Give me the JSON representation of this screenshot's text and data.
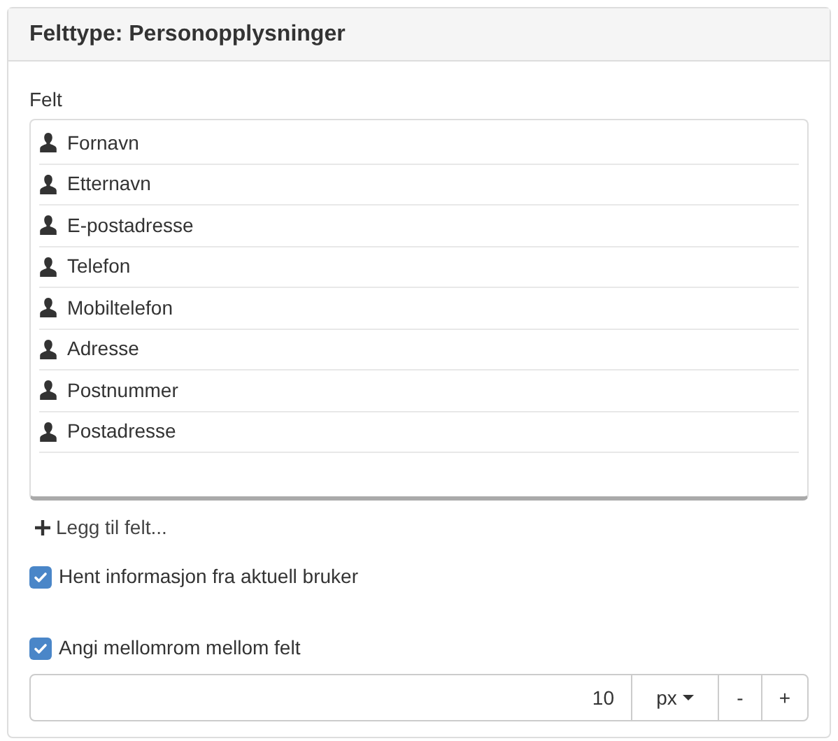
{
  "panel": {
    "title": "Felttype: Personopplysninger"
  },
  "fields": {
    "label": "Felt",
    "items": [
      {
        "label": "Fornavn"
      },
      {
        "label": "Etternavn"
      },
      {
        "label": "E-postadresse"
      },
      {
        "label": "Telefon"
      },
      {
        "label": "Mobiltelefon"
      },
      {
        "label": "Adresse"
      },
      {
        "label": "Postnummer"
      },
      {
        "label": "Postadresse"
      }
    ],
    "add_link": "Legg til felt..."
  },
  "options": [
    {
      "label": "Hent informasjon fra aktuell bruker",
      "checked": true
    },
    {
      "label": "Angi mellomrom mellom felt",
      "checked": true
    }
  ],
  "spacing": {
    "value": "10",
    "unit": "px",
    "decrement": "-",
    "increment": "+"
  }
}
